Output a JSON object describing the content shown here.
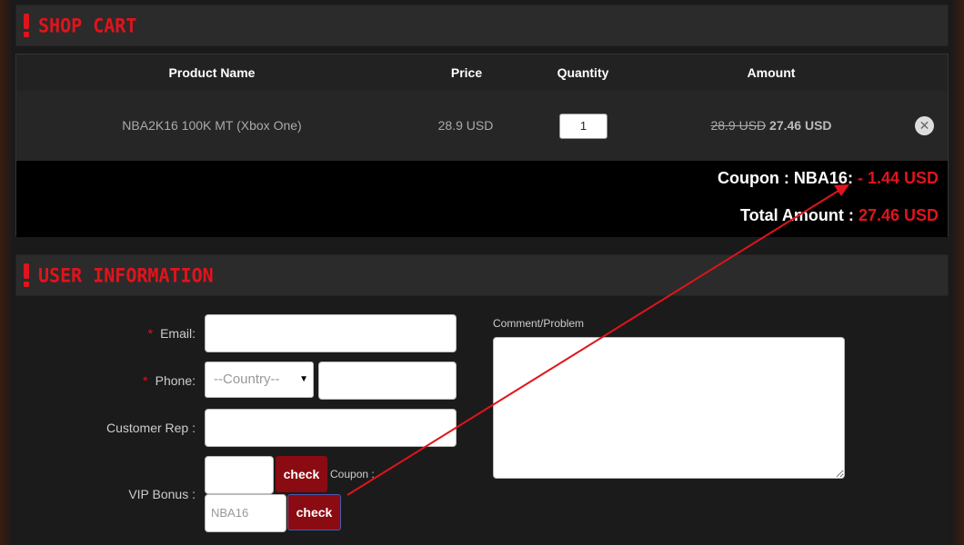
{
  "cart_section": {
    "title": "SHOP CART"
  },
  "cart_table": {
    "headers": {
      "product": "Product Name",
      "price": "Price",
      "quantity": "Quantity",
      "amount": "Amount"
    },
    "row": {
      "product": "NBA2K16 100K MT (Xbox One)",
      "price": "28.9 USD",
      "quantity": "1",
      "amount_original": "28.9 USD",
      "amount_final": "27.46 USD"
    }
  },
  "totals": {
    "coupon_label": "Coupon : NBA16:",
    "coupon_value": "- 1.44 USD",
    "total_label": "Total Amount :",
    "total_value": "27.46 USD"
  },
  "user_section": {
    "title": "USER INFORMATION"
  },
  "form": {
    "email_label": "Email:",
    "phone_label": "Phone:",
    "country_placeholder": "--Country--",
    "customer_rep_label": "Customer Rep :",
    "vip_bonus_label": "VIP Bonus :",
    "check_label": "check",
    "coupon_label": "Coupon :",
    "coupon_value": "NBA16",
    "comment_label": "Comment/Problem",
    "required_mark": "*"
  },
  "colors": {
    "accent": "#e0141c",
    "button": "#8b0b12",
    "annotation_arrow": "#e0141c"
  }
}
